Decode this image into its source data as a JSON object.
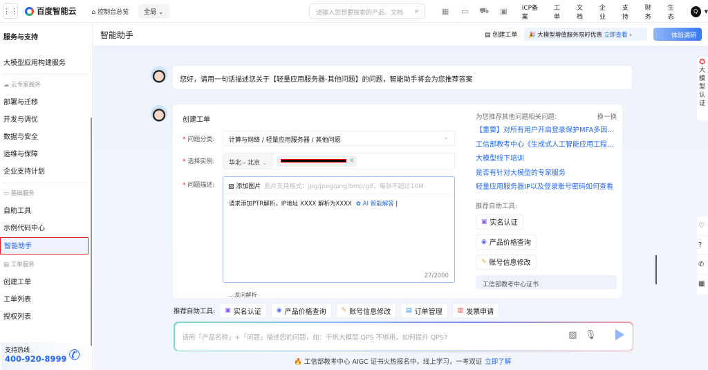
{
  "topbar": {
    "brand": "百度智能云",
    "console": "控制台总览",
    "scope": "全局",
    "search_placeholder": "请输入您想要搜索的产品、文档",
    "links": [
      "ICP备案",
      "工单",
      "文档",
      "企业",
      "支持",
      "财务",
      "生态"
    ],
    "avatar": "Q"
  },
  "sidebar": {
    "title": "服务与支持",
    "top_item": "大模型应用构建服务",
    "groups": [
      {
        "label": "云专家服务",
        "items": [
          "部署与迁移",
          "开发与调优",
          "数据与安全",
          "运维与保障",
          "企业支持计划"
        ]
      },
      {
        "label": "基础服务",
        "items": [
          "自助工具",
          "示例代码中心",
          "智能助手"
        ]
      },
      {
        "label": "工单服务",
        "items": [
          "创建工单",
          "工单列表",
          "授权列表"
        ]
      }
    ],
    "hotline_label": "支持热线",
    "hotline": "400-920-8999"
  },
  "header": {
    "title": "智能助手",
    "create_ticket": "创建工单",
    "promo": "大模型增值服务限时优惠",
    "promo_link": "立即查看 ›",
    "survey": "体验调研"
  },
  "greeting": "您好，请用一句话描述您关于【轻量应用服务器-其他问题】的问题，智能助手将会为您推荐答案",
  "form": {
    "title": "创建工单",
    "category_label": "问题分类:",
    "category_value": "计算与网络 / 轻量应用服务器 / 其他问题",
    "instance_label": "选择实例:",
    "region": "华北 - 北京",
    "desc_label": "问题描述:",
    "add_image": "添加图片",
    "image_hint": "图片支持格式：jpg/jpeg/png/bmp/gif，每张不超过10M",
    "desc_value": "请求添加PTR解析，IP地址 XXXX 解析为XXXX",
    "ai_answer": "AI 智能解答",
    "counter": "27/2000",
    "cut_text": "...反向解析"
  },
  "recommend": {
    "title": "为您推荐其他问题相关问题:",
    "refresh": "换一换",
    "links": [
      "【重要】对所有用户开启登录保护MFA多因素认证",
      "工信部教考中心《生成式人工智能应用工程师》",
      "大模型线下培训",
      "是否有针对大模型的专家服务",
      "轻量应用服务器IP以及登录账号密码如何查看"
    ],
    "tools_title": "推荐自助工具:",
    "tools": [
      "实名认证",
      "产品价格查询",
      "账号信息修改"
    ],
    "card": "工信部教考中心证书"
  },
  "toolbar": {
    "label": "推荐自助工具:",
    "tools": [
      "实名认证",
      "产品价格查询",
      "账号信息修改",
      "订单管理",
      "发票申请"
    ]
  },
  "chat": {
    "placeholder": "请用「产品名称」+「问题」描述您的问题，如：千帆大模型 QPS 不够用，如何提升 QPS?"
  },
  "footer": {
    "text": "工信部教考中心 AIGC 证书火热报名中，线上学习，一考双证",
    "link": "立即了解"
  },
  "float": {
    "label": "大模型认证"
  }
}
